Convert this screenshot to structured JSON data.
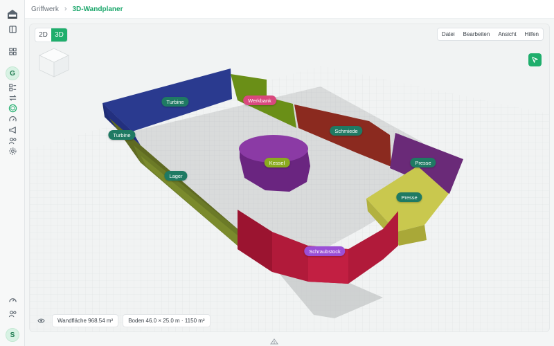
{
  "breadcrumb": {
    "root": "Griffwerk",
    "current": "3D-Wandplaner"
  },
  "view_toggle": {
    "opt_2d": "2D",
    "opt_3d": "3D",
    "active": "3D"
  },
  "menu": {
    "items": [
      "Datei",
      "Bearbeiten",
      "Ansicht",
      "Hilfen"
    ]
  },
  "sidebar": {
    "workspace_avatar": "G",
    "user_avatar": "S",
    "icons": [
      "logo-icon",
      "panel-toggle-icon",
      "dashboard-icon",
      "list-icon",
      "transfer-icon",
      "cube-icon",
      "gauge-icon",
      "megaphone-icon",
      "users-icon",
      "settings-icon",
      "speedometer-icon",
      "team-icon"
    ]
  },
  "stats": {
    "wall_area": "Wandfläche 968.54 m²",
    "floor": "Boden 46.0 × 25.0 m · 1150 m²"
  },
  "walls": [
    {
      "label": "Turbine",
      "color": "#1f7a63"
    },
    {
      "label": "Turbine",
      "color": "#1f7a63"
    },
    {
      "label": "Werkbank",
      "color": "#d9487d"
    },
    {
      "label": "Schmiede",
      "color": "#1f7a63"
    },
    {
      "label": "Lager",
      "color": "#1f7a63"
    },
    {
      "label": "Kessel",
      "color": "#8aab1f"
    },
    {
      "label": "Presse",
      "color": "#1f7a63"
    },
    {
      "label": "Presse",
      "color": "#1f7a63"
    },
    {
      "label": "Schraubstock",
      "color": "#9b4fd6"
    }
  ],
  "colors": {
    "accent": "#1fae6c"
  }
}
